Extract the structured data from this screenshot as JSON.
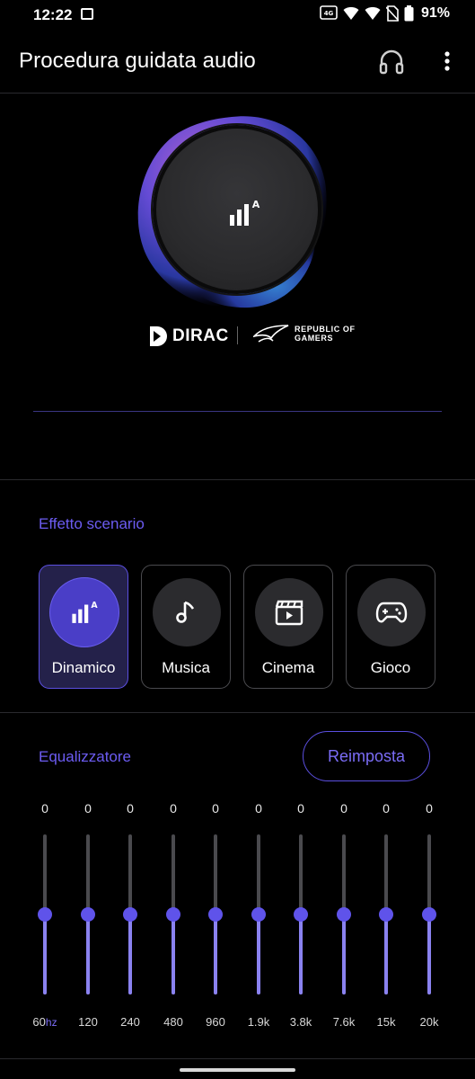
{
  "status_bar": {
    "time": "12:22",
    "battery": "91%"
  },
  "app_bar": {
    "title": "Procedura guidata audio"
  },
  "hero": {
    "brand_dirac": "DIRAC",
    "brand_rog_line1": "REPUBLIC OF",
    "brand_rog_line2": "GAMERS"
  },
  "scenario": {
    "label": "Effetto scenario",
    "items": [
      {
        "label": "Dinamico",
        "icon": "dynamic-icon",
        "selected": true
      },
      {
        "label": "Musica",
        "icon": "music-note-icon",
        "selected": false
      },
      {
        "label": "Cinema",
        "icon": "clapperboard-icon",
        "selected": false
      },
      {
        "label": "Gioco",
        "icon": "gamepad-icon",
        "selected": false
      }
    ]
  },
  "equalizer": {
    "label": "Equalizzatore",
    "reset_label": "Reimposta",
    "hz_unit": "hz",
    "range_db": [
      -12,
      12
    ],
    "bands": [
      {
        "freq": "60",
        "value": "0"
      },
      {
        "freq": "120",
        "value": "0"
      },
      {
        "freq": "240",
        "value": "0"
      },
      {
        "freq": "480",
        "value": "0"
      },
      {
        "freq": "960",
        "value": "0"
      },
      {
        "freq": "1.9k",
        "value": "0"
      },
      {
        "freq": "3.8k",
        "value": "0"
      },
      {
        "freq": "7.6k",
        "value": "0"
      },
      {
        "freq": "15k",
        "value": "0"
      },
      {
        "freq": "20k",
        "value": "0"
      }
    ]
  },
  "colors": {
    "accent": "#5f53ea",
    "accent_text": "#6c5cf2",
    "active_card_bg": "#24214a",
    "background": "#000000"
  }
}
